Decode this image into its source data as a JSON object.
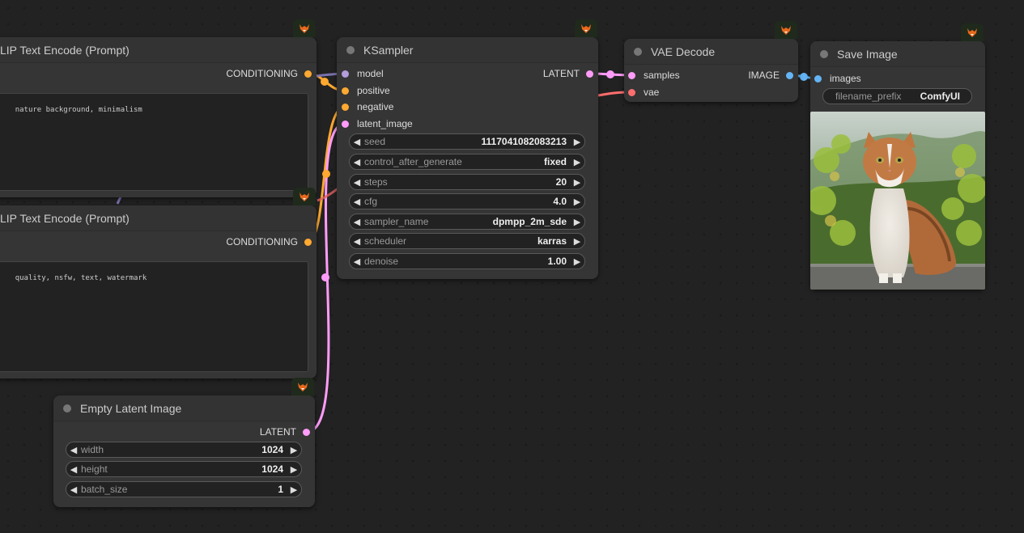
{
  "colors": {
    "clip": "#ffa931",
    "model": "#b39ddb",
    "latent": "#ff9cf9",
    "vae": "#ff6e6e",
    "image": "#64b5f6"
  },
  "clip_positive": {
    "title": "LIP Text Encode (Prompt)",
    "output_label": "CONDITIONING",
    "text": "nature background, minimalism"
  },
  "clip_negative": {
    "title": "LIP Text Encode (Prompt)",
    "output_label": "CONDITIONING",
    "text": "quality, nsfw, text, watermark"
  },
  "ksampler": {
    "title": "KSampler",
    "inputs": [
      "model",
      "positive",
      "negative",
      "latent_image"
    ],
    "output_label": "LATENT",
    "widgets": [
      {
        "label": "seed",
        "value": "1117041082083213"
      },
      {
        "label": "control_after_generate",
        "value": "fixed"
      },
      {
        "label": "steps",
        "value": "20"
      },
      {
        "label": "cfg",
        "value": "4.0"
      },
      {
        "label": "sampler_name",
        "value": "dpmpp_2m_sde"
      },
      {
        "label": "scheduler",
        "value": "karras"
      },
      {
        "label": "denoise",
        "value": "1.00"
      }
    ]
  },
  "vae_decode": {
    "title": "VAE Decode",
    "inputs": [
      "samples",
      "vae"
    ],
    "output_label": "IMAGE"
  },
  "save_image": {
    "title": "Save Image",
    "input_label": "images",
    "filename_prefix_label": "filename_prefix",
    "filename_prefix_value": "ComfyUI"
  },
  "empty_latent": {
    "title": "Empty Latent Image",
    "output_label": "LATENT",
    "widgets": [
      {
        "label": "width",
        "value": "1024"
      },
      {
        "label": "height",
        "value": "1024"
      },
      {
        "label": "batch_size",
        "value": "1"
      }
    ]
  },
  "icons": {
    "badge": "fox-icon",
    "arrow_left": "◀",
    "arrow_right": "▶"
  }
}
